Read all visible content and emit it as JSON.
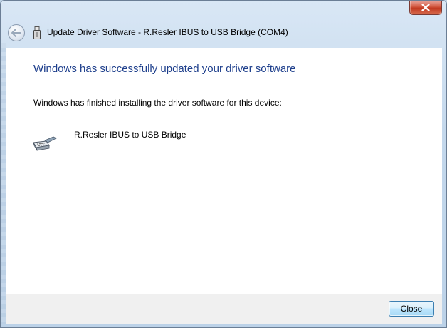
{
  "window": {
    "title": "Update Driver Software - R.Resler IBUS to USB Bridge (COM4)"
  },
  "content": {
    "heading": "Windows has successfully updated your driver software",
    "subtext": "Windows has finished installing the driver software for this device:",
    "device_name": "R.Resler IBUS to USB Bridge"
  },
  "footer": {
    "close_label": "Close"
  },
  "icons": {
    "back": "back-arrow-icon",
    "title": "usb-plug-icon",
    "device": "serial-cable-icon",
    "window_close": "close-icon"
  },
  "colors": {
    "heading": "#1e3f8c",
    "window_close_bg": "#c13a21",
    "button_border": "#3c7fb1"
  }
}
